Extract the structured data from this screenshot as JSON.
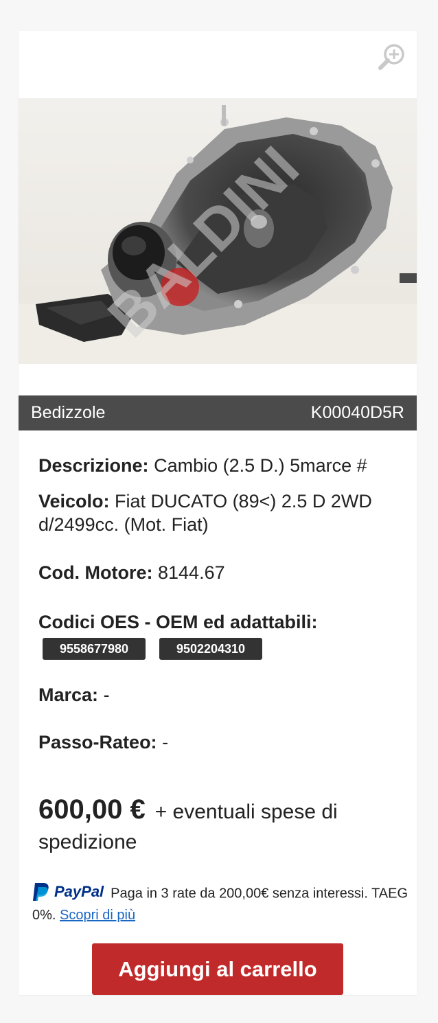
{
  "location": "Bedizzole",
  "part_code": "K00040D5R",
  "watermark": "BALDINI",
  "description": {
    "label": "Descrizione:",
    "value": "Cambio (2.5 D.) 5marce #"
  },
  "vehicle": {
    "label": "Veicolo:",
    "value": "Fiat DUCATO (89<) 2.5 D 2WD d/2499cc. (Mot. Fiat)"
  },
  "engine_code": {
    "label": "Cod. Motore:",
    "value": "8144.67"
  },
  "oem": {
    "label": "Codici OES - OEM ed adattabili:",
    "codes": [
      "9558677980",
      "9502204310"
    ]
  },
  "brand": {
    "label": "Marca:",
    "value": "-"
  },
  "pitch": {
    "label": "Passo-Rateo:",
    "value": "-"
  },
  "price": {
    "amount": "600,00 €",
    "note": "+ eventuali spese di spedizione"
  },
  "paypal": {
    "logo_text": "PayPal",
    "message": "Paga in 3 rate da 200,00€ senza interessi. TAEG 0%.",
    "link": "Scopri di più"
  },
  "cta_label": "Aggiungi al carrello",
  "colors": {
    "bar": "#4b4b4b",
    "cta": "#c12a2a",
    "code_badge": "#333333",
    "link": "#1a66c4"
  },
  "icons": [
    "zoom-in-icon",
    "paypal-icon"
  ]
}
